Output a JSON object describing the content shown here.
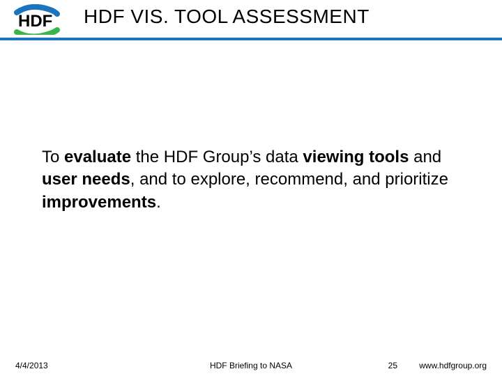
{
  "header": {
    "title": "HDF VIS. TOOL ASSESSMENT",
    "logo_alt": "HDF"
  },
  "body": {
    "segments": [
      {
        "t": "To ",
        "b": false
      },
      {
        "t": "evaluate",
        "b": true
      },
      {
        "t": " the HDF Group’s data ",
        "b": false
      },
      {
        "t": "viewing tools",
        "b": true
      },
      {
        "t": " and ",
        "b": false
      },
      {
        "t": "user needs",
        "b": true
      },
      {
        "t": ", and to explore, recommend, and prioritize ",
        "b": false
      },
      {
        "t": "improvements",
        "b": true
      },
      {
        "t": ".",
        "b": false
      }
    ]
  },
  "footer": {
    "date": "4/4/2013",
    "center": "HDF Briefing to NASA",
    "page": "25",
    "url": "www.hdfgroup.org"
  }
}
